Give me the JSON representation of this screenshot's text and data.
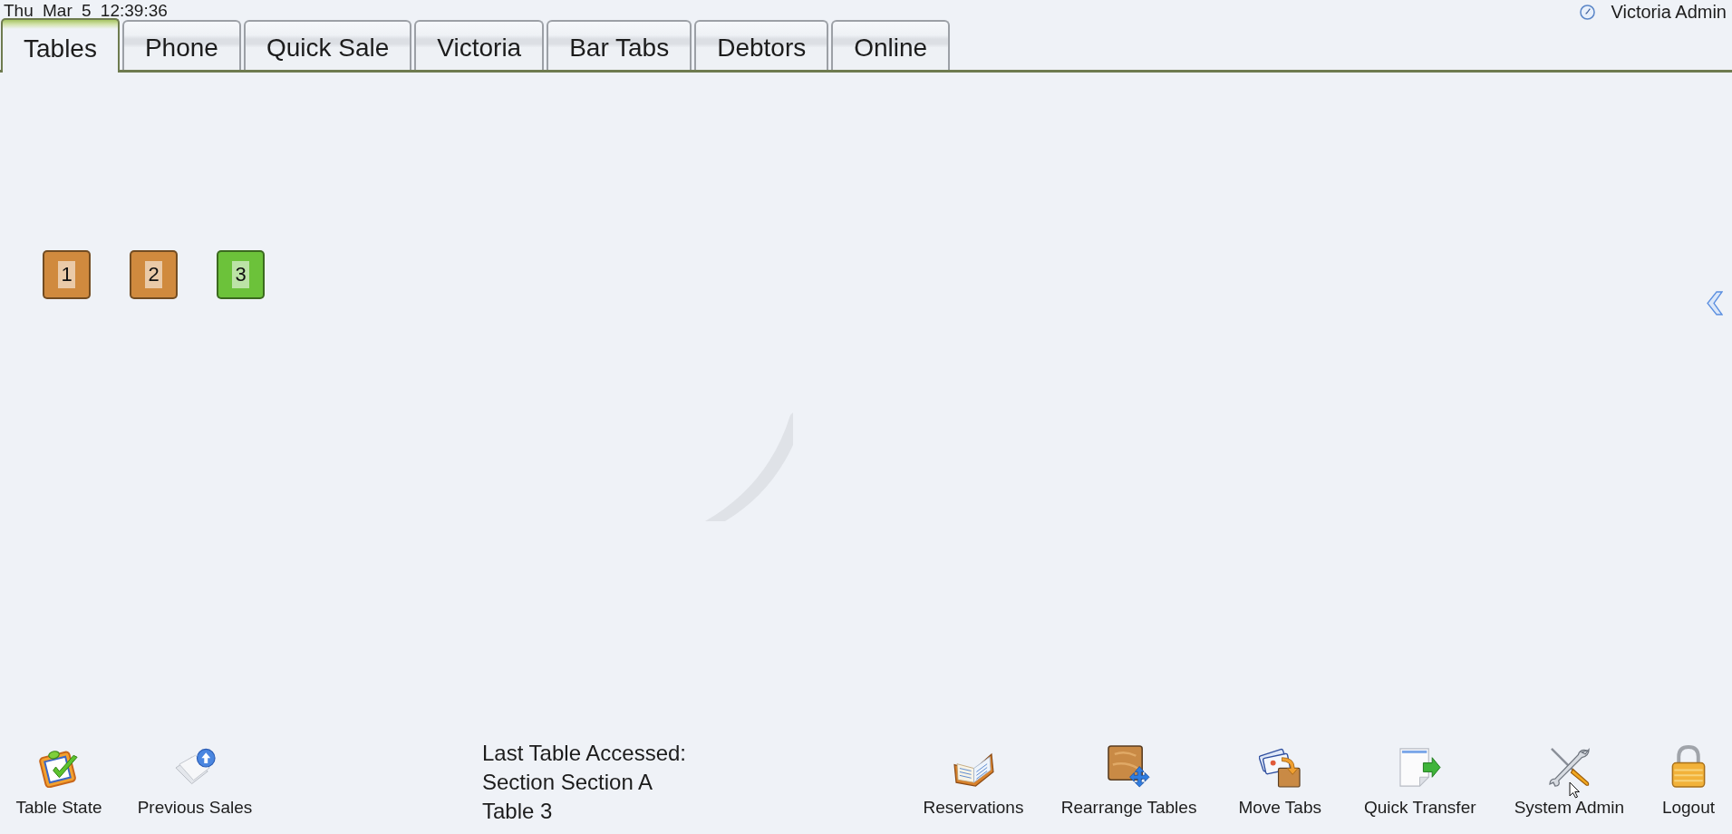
{
  "header": {
    "datetime": "Thu Mar 5 12:39:36",
    "user": "Victoria Admin"
  },
  "tabs": [
    {
      "label": "Tables",
      "selected": true
    },
    {
      "label": "Phone",
      "selected": false
    },
    {
      "label": "Quick Sale",
      "selected": false
    },
    {
      "label": "Victoria",
      "selected": false
    },
    {
      "label": "Bar Tabs",
      "selected": false
    },
    {
      "label": "Debtors",
      "selected": false
    },
    {
      "label": "Online",
      "selected": false
    }
  ],
  "tables": [
    {
      "label": "1",
      "color": "#d08a3e"
    },
    {
      "label": "2",
      "color": "#d08a3e"
    },
    {
      "label": "3",
      "color": "#6cc23a"
    }
  ],
  "toolbar_left": [
    {
      "label": "Table State"
    },
    {
      "label": "Previous Sales"
    }
  ],
  "last_table_accessed": {
    "heading": "Last Table Accessed:",
    "lines": [
      "Section Section A",
      "Table 3"
    ]
  },
  "toolbar_right": [
    {
      "label": "Reservations"
    },
    {
      "label": "Rearrange Tables"
    },
    {
      "label": "Move Tabs"
    },
    {
      "label": "Quick Transfer"
    },
    {
      "label": "System Admin"
    },
    {
      "label": "Logout"
    }
  ]
}
